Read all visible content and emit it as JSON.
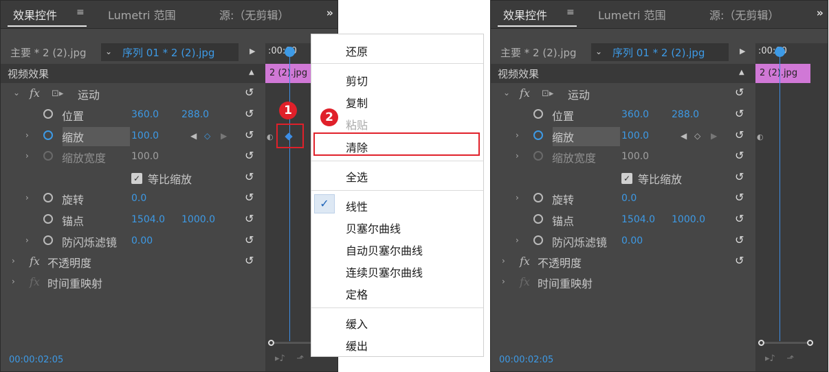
{
  "panel": {
    "tabs": [
      "效果控件",
      "Lumetri 范围",
      "源:（无剪辑）"
    ],
    "tab_menu_icon": "≡",
    "tab_more_icon": "»",
    "master_clip": "主要 * 2 (2).jpg",
    "sequence": "序列 01 * 2 (2).jpg",
    "section": "视频效果",
    "timeline_time": ":00:00",
    "clip_label": "2 (2).jpg",
    "timecode": "00:00:02:05",
    "rows": {
      "motion": "运动",
      "position": {
        "label": "位置",
        "x": "360.0",
        "y": "288.0"
      },
      "scale": {
        "label": "缩放",
        "value": "100.0"
      },
      "scale_width": {
        "label": "缩放宽度",
        "value": "100.0"
      },
      "uniform_scale": "等比缩放",
      "rotation": {
        "label": "旋转",
        "value": "0.0"
      },
      "anchor": {
        "label": "锚点",
        "x": "1504.0",
        "y": "1000.0"
      },
      "anti_flicker": {
        "label": "防闪烁滤镜",
        "value": "0.00"
      },
      "opacity": "不透明度",
      "time_remap": "时间重映射"
    },
    "icons": {
      "fx": "fx",
      "reset": "↺"
    }
  },
  "menu": {
    "items": [
      "还原",
      "剪切",
      "复制",
      "粘贴",
      "清除",
      "全选",
      "线性",
      "贝塞尔曲线",
      "自动贝塞尔曲线",
      "连续贝塞尔曲线",
      "定格",
      "缓入",
      "缓出"
    ],
    "check_mark": "✓"
  },
  "badges": [
    "1",
    "2"
  ],
  "colors": {
    "accent": "#3d9ae6",
    "highlight": "#e0202a",
    "clip": "#d078d6",
    "panel_bg": "#464646"
  }
}
